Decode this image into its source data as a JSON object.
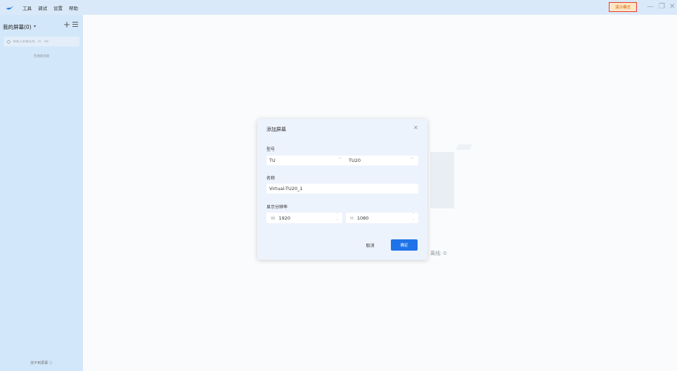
{
  "menu": [
    "工具",
    "调试",
    "设置",
    "帮助"
  ],
  "demo_mode": "演示模式",
  "window_controls": {
    "minimize": "—",
    "restore": "❐",
    "close": "✕"
  },
  "sidebar": {
    "title": "我的屏幕(0)",
    "caret": "▾",
    "add": "+",
    "search_placeholder": "请输入屏幕名称、IP、SN",
    "empty_text": "无搜索结果",
    "not_found": "找不到屏幕 ⓘ"
  },
  "main": {
    "offline_label": "离线: 0"
  },
  "dialog": {
    "title": "添加屏幕",
    "close": "✕",
    "model_label": "型号",
    "model_series": "TU",
    "model_value": "TU20",
    "name_label": "名称",
    "name_value": "Virtual-TU20_1",
    "resolution_label": "显示分辨率",
    "width_prefix": "W",
    "width_value": "1920",
    "height_prefix": "H",
    "height_value": "1080",
    "cancel": "取消",
    "confirm": "确定"
  },
  "colors": {
    "accent": "#1e73e8",
    "sidebar_bg": "#d3e7fa",
    "titlebar_bg": "#d9e9f9",
    "demo_border": "#e83a2b"
  }
}
